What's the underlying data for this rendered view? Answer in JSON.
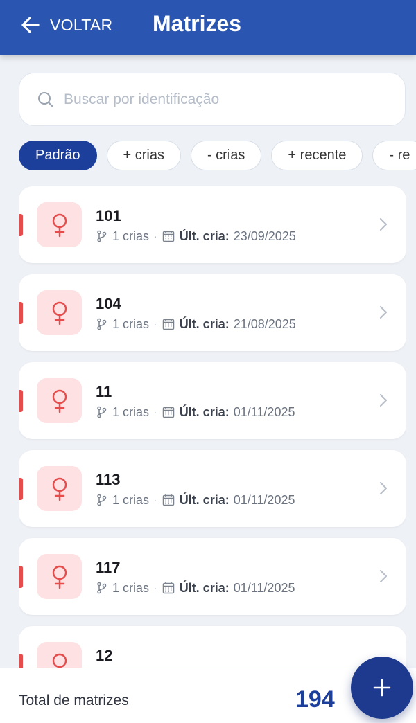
{
  "header": {
    "back_label": "VOLTAR",
    "title": "Matrizes"
  },
  "search": {
    "placeholder": "Buscar por identificação",
    "value": ""
  },
  "filters": [
    {
      "label": "Padrão",
      "active": true
    },
    {
      "label": "+ crias",
      "active": false
    },
    {
      "label": "- crias",
      "active": false
    },
    {
      "label": "+ recente",
      "active": false
    },
    {
      "label": "- re",
      "active": false
    }
  ],
  "matrices": [
    {
      "id": "101",
      "crias": "1 crias",
      "last_label": "Últ. cria:",
      "last_date": "23/09/2025"
    },
    {
      "id": "104",
      "crias": "1 crias",
      "last_label": "Últ. cria:",
      "last_date": "21/08/2025"
    },
    {
      "id": "11",
      "crias": "1 crias",
      "last_label": "Últ. cria:",
      "last_date": "01/11/2025"
    },
    {
      "id": "113",
      "crias": "1 crias",
      "last_label": "Últ. cria:",
      "last_date": "01/11/2025"
    },
    {
      "id": "117",
      "crias": "1 crias",
      "last_label": "Últ. cria:",
      "last_date": "01/11/2025"
    },
    {
      "id": "12",
      "crias": "",
      "last_label": "",
      "last_date": ""
    }
  ],
  "footer": {
    "total_label": "Total de matrizes",
    "total_count": "194"
  },
  "colors": {
    "header": "#2a55b0",
    "accent": "#1d3f9c",
    "female": "#e54c4c",
    "female_bg": "#fde1e3"
  },
  "icons": {
    "back": "arrow-left-icon",
    "search": "search-icon",
    "female": "female-icon",
    "branch": "branch-icon",
    "calendar": "calendar-icon",
    "chevron": "chevron-right-icon",
    "add": "plus-icon"
  }
}
